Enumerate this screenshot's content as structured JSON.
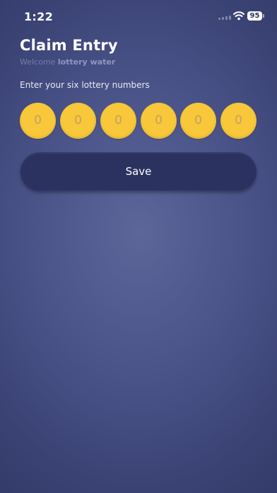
{
  "status_bar": {
    "time": "1:22",
    "battery": "95",
    "icons": [
      "signal-icon",
      "wifi-icon",
      "battery-icon"
    ]
  },
  "header": {
    "title": "Claim Entry",
    "welcome_prefix": "Welcome",
    "username": "lottery water"
  },
  "form": {
    "instruction": "Enter your six lottery numbers",
    "digits": [
      "0",
      "0",
      "0",
      "0",
      "0",
      "0"
    ],
    "save_label": "Save"
  },
  "colors": {
    "background": "#4a5388",
    "digit_fill": "#f8c73a",
    "digit_text": "#c3a35d",
    "button_fill": "#2c3260",
    "muted_text": "#737ca8"
  }
}
